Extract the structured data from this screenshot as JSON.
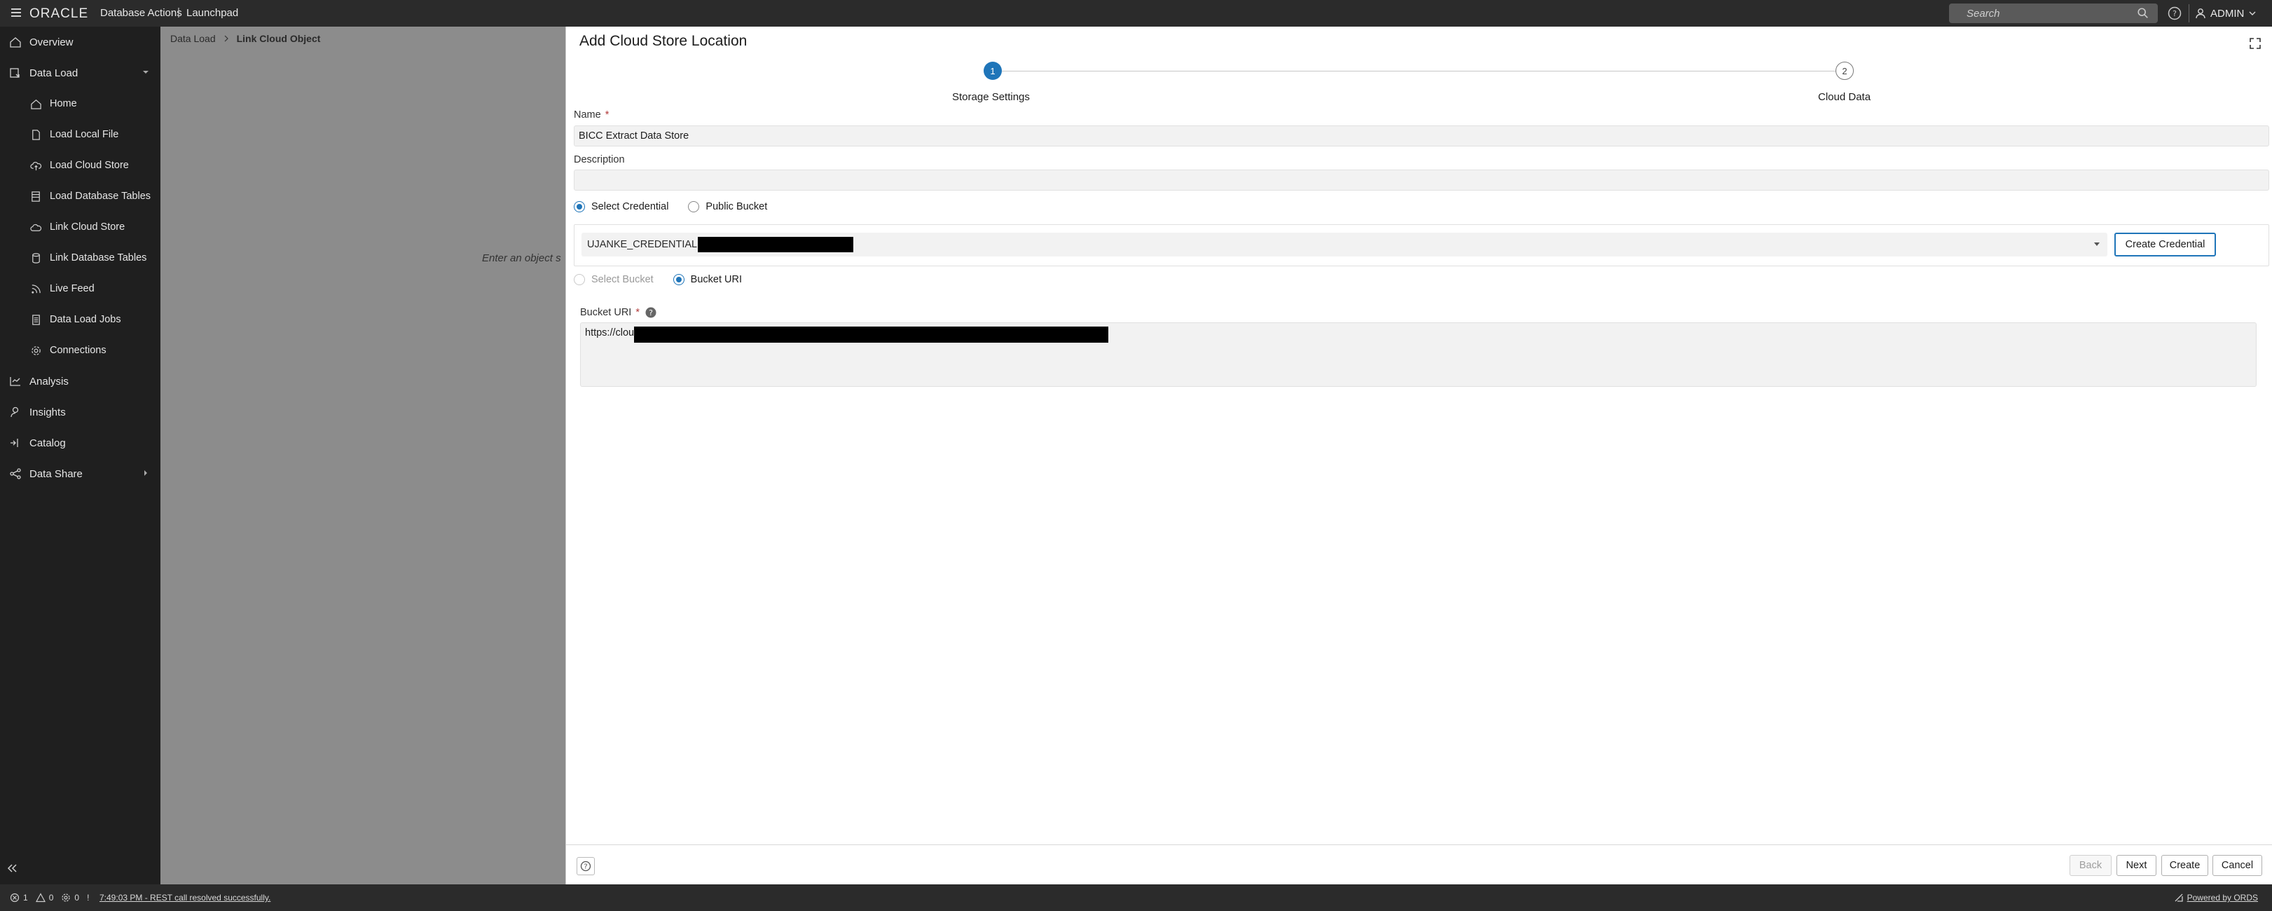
{
  "header": {
    "logo": "ORACLE",
    "product": "Database Actions",
    "separator": "|",
    "section": "Launchpad",
    "search_placeholder": "Search",
    "user": "ADMIN"
  },
  "sidebar": {
    "items": [
      {
        "label": "Overview",
        "icon": "home-icon"
      },
      {
        "label": "Data Load",
        "icon": "data-load-icon"
      },
      {
        "label": "Home",
        "icon": "home-icon"
      },
      {
        "label": "Load Local File",
        "icon": "file-icon"
      },
      {
        "label": "Load Cloud Store",
        "icon": "cloud-upload-icon"
      },
      {
        "label": "Load Database Tables",
        "icon": "database-tables-icon"
      },
      {
        "label": "Link Cloud Store",
        "icon": "cloud-icon"
      },
      {
        "label": "Link Database Tables",
        "icon": "database-icon"
      },
      {
        "label": "Live Feed",
        "icon": "feed-icon"
      },
      {
        "label": "Data Load Jobs",
        "icon": "jobs-icon"
      },
      {
        "label": "Connections",
        "icon": "gear-icon"
      },
      {
        "label": "Analysis",
        "icon": "analysis-icon"
      },
      {
        "label": "Insights",
        "icon": "insights-icon"
      },
      {
        "label": "Catalog",
        "icon": "catalog-icon"
      },
      {
        "label": "Data Share",
        "icon": "share-icon"
      }
    ]
  },
  "breadcrumb": {
    "parent": "Data Load",
    "current": "Link Cloud Object"
  },
  "background": {
    "hint": "Enter an object s"
  },
  "panel": {
    "title": "Add Cloud Store Location",
    "steps": [
      {
        "number": "1",
        "label": "Storage Settings"
      },
      {
        "number": "2",
        "label": "Cloud Data"
      }
    ],
    "name_label": "Name",
    "name_value": "BICC Extract Data Store",
    "description_label": "Description",
    "description_value": "",
    "credential_options": {
      "select_credential": "Select Credential",
      "public_bucket": "Public Bucket"
    },
    "credential_value": "UJANKE_CREDENTIAL",
    "create_credential": "Create Credential",
    "bucket_options": {
      "select_bucket": "Select Bucket",
      "bucket_uri": "Bucket URI"
    },
    "bucket_uri_label": "Bucket URI",
    "bucket_uri_value": "https://clou",
    "required_mark": "*",
    "footer": {
      "back": "Back",
      "next": "Next",
      "create": "Create",
      "cancel": "Cancel"
    }
  },
  "status": {
    "errors": "1",
    "warnings": "0",
    "settings": "0",
    "info": "!",
    "message": "7:49:03 PM - REST call resolved successfully.",
    "powered_by": "Powered by ORDS"
  },
  "colors": {
    "accent": "#1f75b9",
    "header_bg": "#2b2b2b",
    "sidebar_bg": "#1f1f1f"
  }
}
